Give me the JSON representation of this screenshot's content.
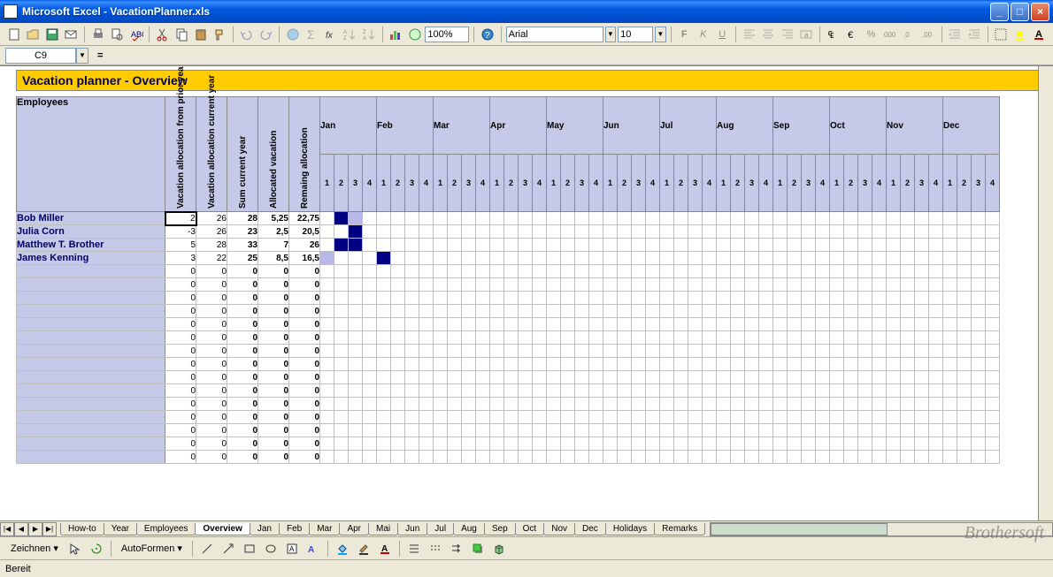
{
  "window": {
    "app": "Microsoft Excel",
    "file": "VacationPlanner.xls"
  },
  "toolbar": {
    "zoom": "100%",
    "font": "Arial",
    "size": "10"
  },
  "formula": {
    "namebox": "C9",
    "value": ""
  },
  "sheet": {
    "title": "Vacation planner - Overview",
    "emp_header": "Employees",
    "col_headers": [
      "Vacation allocation from prior year",
      "Vacation allocation current year",
      "Sum current year",
      "Allocated vacation",
      "Remaing allocation"
    ],
    "months": [
      "Jan",
      "Feb",
      "Mar",
      "Apr",
      "May",
      "Jun",
      "Jul",
      "Aug",
      "Sep",
      "Oct",
      "Nov",
      "Dec"
    ],
    "weeks": [
      "1",
      "2",
      "3",
      "4"
    ],
    "employees": [
      {
        "name": "Bob Miller",
        "v": [
          "2",
          "26",
          "28",
          "5,25",
          "22,75"
        ],
        "marks": [
          {
            "m": 0,
            "w": 1,
            "c": "dark"
          },
          {
            "m": 0,
            "w": 2,
            "c": "light"
          }
        ]
      },
      {
        "name": "Julia Corn",
        "v": [
          "-3",
          "26",
          "23",
          "2,5",
          "20,5"
        ],
        "marks": [
          {
            "m": 0,
            "w": 2,
            "c": "dark"
          }
        ]
      },
      {
        "name": "Matthew T. Brother",
        "v": [
          "5",
          "28",
          "33",
          "7",
          "26"
        ],
        "marks": [
          {
            "m": 0,
            "w": 1,
            "c": "dark"
          },
          {
            "m": 0,
            "w": 2,
            "c": "dark"
          }
        ]
      },
      {
        "name": "James Kenning",
        "v": [
          "3",
          "22",
          "25",
          "8,5",
          "16,5"
        ],
        "marks": [
          {
            "m": 0,
            "w": 0,
            "c": "light"
          },
          {
            "m": 1,
            "w": 0,
            "c": "dark"
          }
        ]
      }
    ],
    "empty_rows": 15
  },
  "tabs": {
    "list": [
      "How-to",
      "Year",
      "Employees",
      "Overview",
      "Jan",
      "Feb",
      "Mar",
      "Apr",
      "Mai",
      "Jun",
      "Jul",
      "Aug",
      "Sep",
      "Oct",
      "Nov",
      "Dec",
      "Holidays",
      "Remarks"
    ],
    "active": "Overview"
  },
  "drawing": {
    "label": "Zeichnen",
    "autoforms": "AutoFormen"
  },
  "status": {
    "text": "Bereit"
  },
  "watermark": "Brothersoft"
}
